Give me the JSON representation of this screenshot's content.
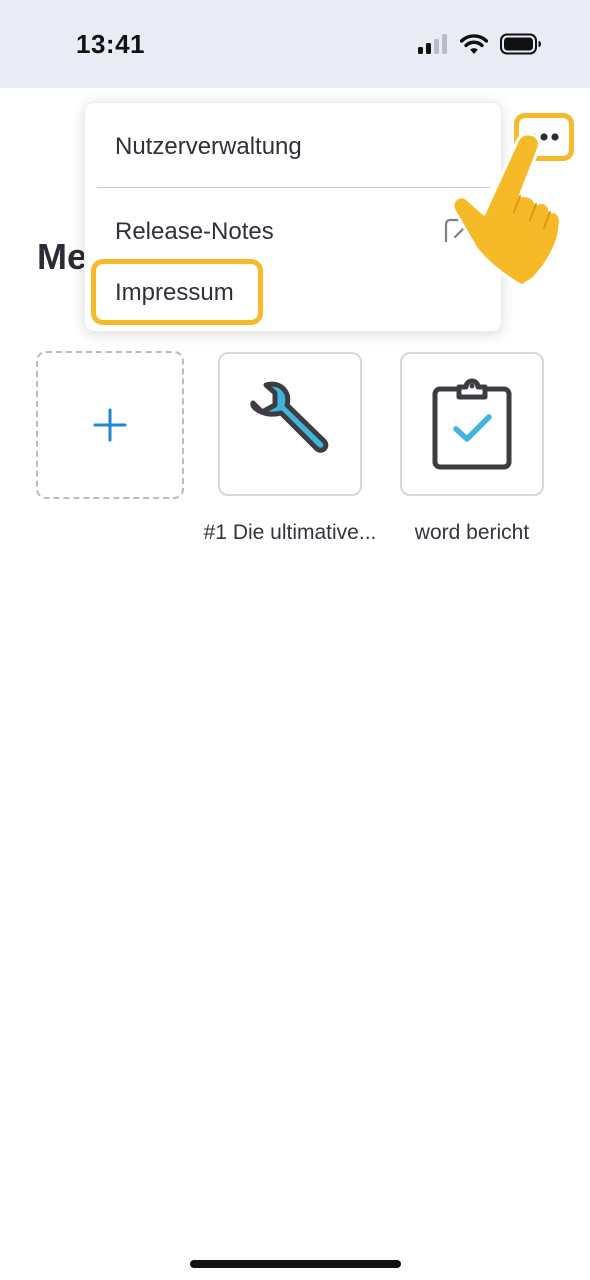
{
  "status_bar": {
    "time": "13:41"
  },
  "page": {
    "title": "Me"
  },
  "menu": {
    "items": [
      {
        "label": "Nutzerverwaltung"
      },
      {
        "label": "Release-Notes"
      },
      {
        "label": "Impressum"
      }
    ]
  },
  "tiles": [
    {
      "icon": "plus-icon",
      "label": ""
    },
    {
      "icon": "wrench-icon",
      "label": "#1 Die ultimative..."
    },
    {
      "icon": "clipboard-check-icon",
      "label": "word bericht"
    }
  ],
  "colors": {
    "highlight": "#f6b928",
    "accent": "#1e88d6",
    "icon_fill": "#3fb4dd",
    "icon_stroke": "#3c3c42",
    "status_bar_bg": "#e9ecf5"
  }
}
